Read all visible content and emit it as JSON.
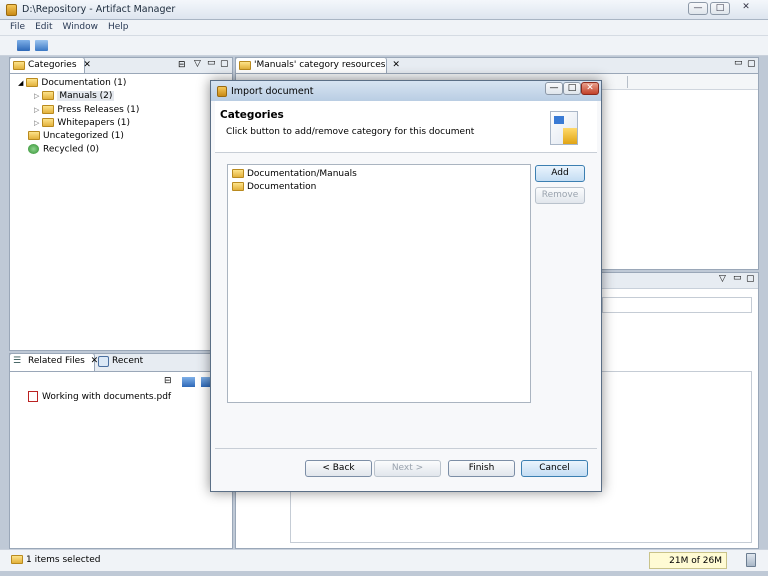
{
  "window": {
    "title": "D:\\Repository - Artifact Manager"
  },
  "menu": [
    "File",
    "Edit",
    "Window",
    "Help"
  ],
  "categories_panel": {
    "tab": "Categories",
    "tree": [
      {
        "label": "Documentation (1)",
        "expander": "◢"
      },
      {
        "label": "Manuals (2)",
        "expander": "▷"
      },
      {
        "label": "Press Releases (1)",
        "expander": "▷"
      },
      {
        "label": "Whitepapers (1)",
        "expander": "▷"
      },
      {
        "label": "Uncategorized (1)"
      },
      {
        "label": "Recycled (0)"
      }
    ]
  },
  "related_panel": {
    "tab_related": "Related Files",
    "tab_recent": "Recent",
    "files": [
      "Working with documents.pdf"
    ]
  },
  "editor_panel": {
    "tab": "'Manuals' category resources"
  },
  "dialog": {
    "title": "Import document",
    "heading": "Categories",
    "description": "Click button to add/remove category for this document",
    "list": [
      "Documentation/Manuals",
      "Documentation"
    ],
    "add": "Add",
    "remove": "Remove",
    "back": "< Back",
    "next": "Next >",
    "finish": "Finish",
    "cancel": "Cancel"
  },
  "status": {
    "selection": "1 items selected",
    "memory": "21M of 26M"
  }
}
